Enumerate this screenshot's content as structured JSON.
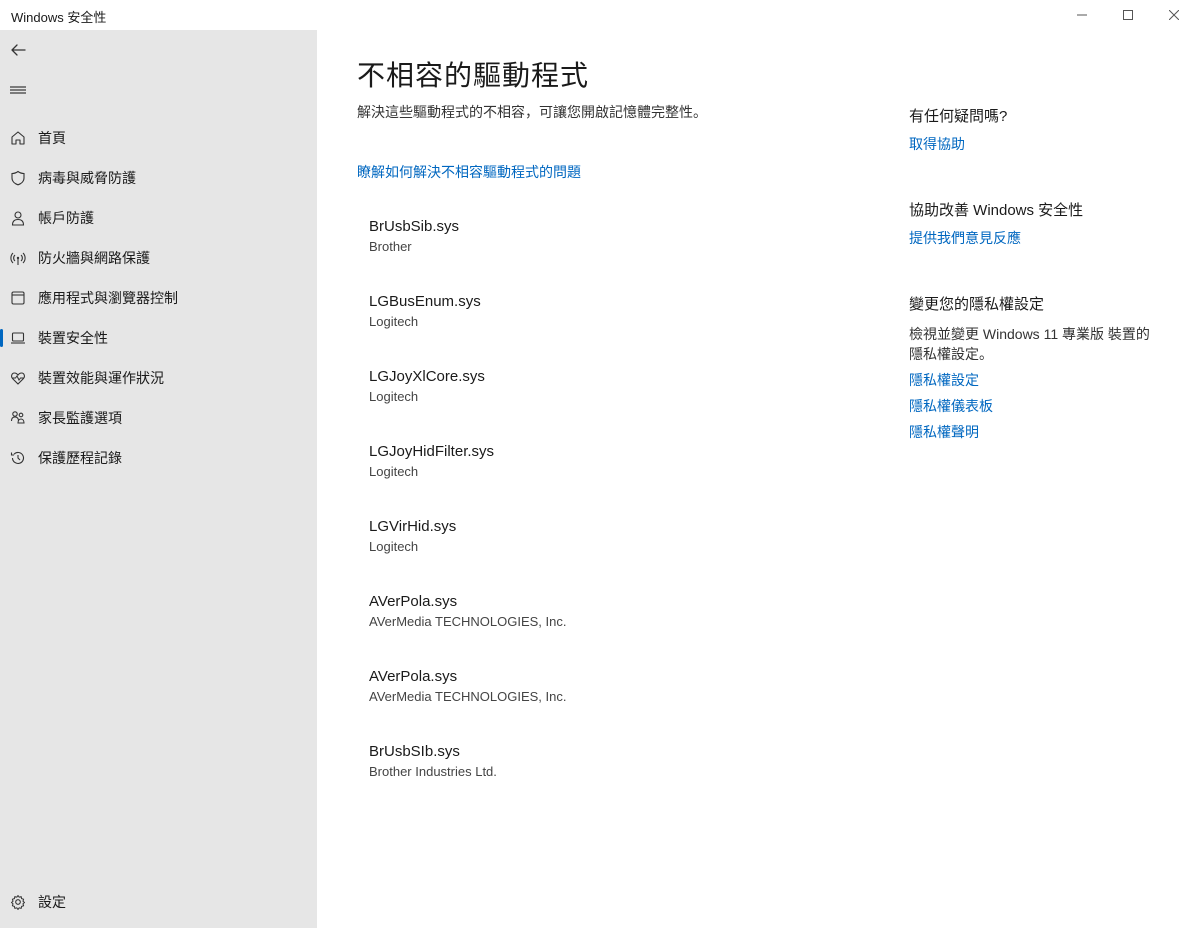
{
  "window": {
    "title": "Windows 安全性"
  },
  "sidebar": {
    "items": [
      {
        "label": "首頁",
        "icon": "home-icon"
      },
      {
        "label": "病毒與威脅防護",
        "icon": "shield-icon"
      },
      {
        "label": "帳戶防護",
        "icon": "person-icon"
      },
      {
        "label": "防火牆與網路保護",
        "icon": "wireless-icon"
      },
      {
        "label": "應用程式與瀏覽器控制",
        "icon": "app-window-icon"
      },
      {
        "label": "裝置安全性",
        "icon": "laptop-icon",
        "active": true
      },
      {
        "label": "裝置效能與運作狀況",
        "icon": "heart-pulse-icon"
      },
      {
        "label": "家長監護選項",
        "icon": "family-icon"
      },
      {
        "label": "保護歷程記錄",
        "icon": "history-icon"
      }
    ],
    "settings_label": "設定"
  },
  "main": {
    "title": "不相容的驅動程式",
    "description": "解決這些驅動程式的不相容，可讓您開啟記憶體完整性。",
    "learn_link": "瞭解如何解決不相容驅動程式的問題",
    "drivers": [
      {
        "name": "BrUsbSib.sys",
        "vendor": "Brother"
      },
      {
        "name": "LGBusEnum.sys",
        "vendor": "Logitech"
      },
      {
        "name": "LGJoyXlCore.sys",
        "vendor": "Logitech"
      },
      {
        "name": "LGJoyHidFilter.sys",
        "vendor": "Logitech"
      },
      {
        "name": "LGVirHid.sys",
        "vendor": "Logitech"
      },
      {
        "name": "AVerPola.sys",
        "vendor": "AVerMedia TECHNOLOGIES, Inc."
      },
      {
        "name": "AVerPola.sys",
        "vendor": "AVerMedia TECHNOLOGIES, Inc."
      },
      {
        "name": "BrUsbSIb.sys",
        "vendor": "Brother Industries Ltd."
      }
    ]
  },
  "aside": {
    "help": {
      "heading": "有任何疑問嗎?",
      "link": "取得協助"
    },
    "improve": {
      "heading": "協助改善 Windows 安全性",
      "link": "提供我們意見反應"
    },
    "privacy": {
      "heading": "變更您的隱私權設定",
      "text": "檢視並變更 Windows 11 專業版 裝置的隱私權設定。",
      "links": [
        "隱私權設定",
        "隱私權儀表板",
        "隱私權聲明"
      ]
    }
  },
  "colors": {
    "accent": "#0067c0",
    "sidebar_bg": "#e6e6e6"
  }
}
